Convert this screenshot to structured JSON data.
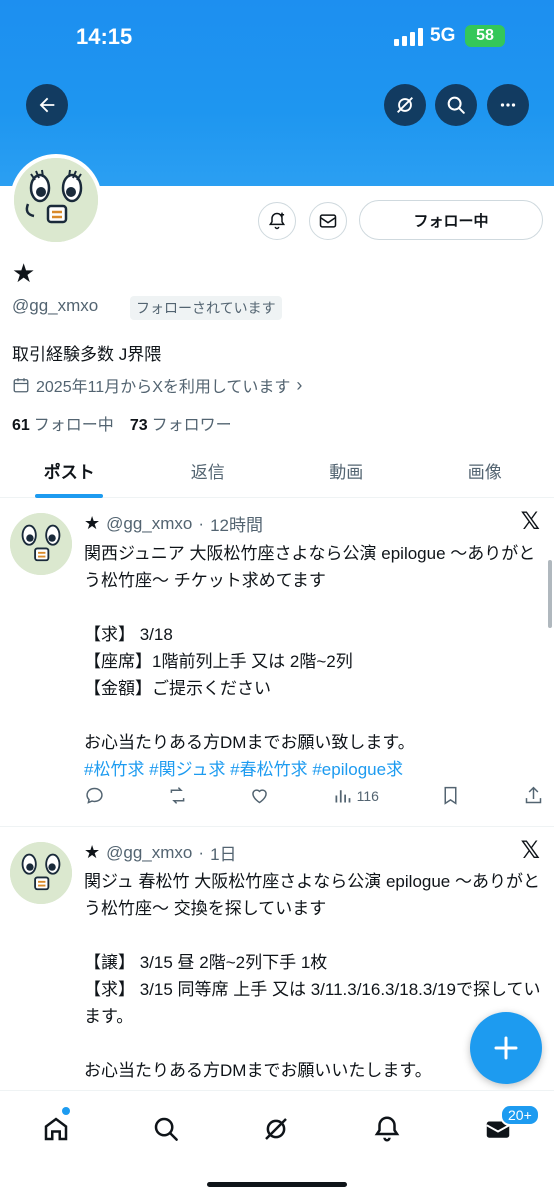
{
  "status_bar": {
    "time": "14:15",
    "network": "5G",
    "battery": "58"
  },
  "profile": {
    "name": "★",
    "handle": "@gg_xmxo",
    "follows_you": "フォローされています",
    "bio": "取引経験多数 J界隈",
    "joined": "2025年11月からXを利用しています",
    "following_count": "61",
    "following_label": "フォロー中",
    "followers_count": "73",
    "followers_label": "フォロワー",
    "follow_button": "フォロー中"
  },
  "tabs": [
    {
      "label": "ポスト",
      "active": true
    },
    {
      "label": "返信",
      "active": false
    },
    {
      "label": "動画",
      "active": false
    },
    {
      "label": "画像",
      "active": false
    }
  ],
  "posts": [
    {
      "author": "★",
      "handle": "@gg_xmxo",
      "time": "12時間",
      "text": "関西ジュニア 大阪松竹座さよなら公演 epilogue 〜ありがとう松竹座〜 チケット求めてます\n\n【求】 3/18\n【座席】1階前列上手 又は 2階~2列\n【金額】ご提示ください\n\nお心当たりある方DMまでお願い致します。",
      "hashtags": "#松竹求 #関ジュ求 #春松竹求 #epilogue求",
      "views": "116"
    },
    {
      "author": "★",
      "handle": "@gg_xmxo",
      "time": "1日",
      "text": "関ジュ 春松竹 大阪松竹座さよなら公演 epilogue 〜ありがとう松竹座〜 交換を探しています\n\n【譲】 3/15 昼 2階~2列下手 1枚\n【求】 3/15 同等席 上手 又は 3/11.3/16.3/18.3/19で探しています。\n\nお心当たりある方DMまでお願いいたします。"
    }
  ],
  "bottom_nav": {
    "messages_badge": "20+"
  },
  "colors": {
    "accent": "#1d9bf0",
    "banner": "#1e96f0",
    "text": "#0f1419",
    "muted": "#536471"
  }
}
